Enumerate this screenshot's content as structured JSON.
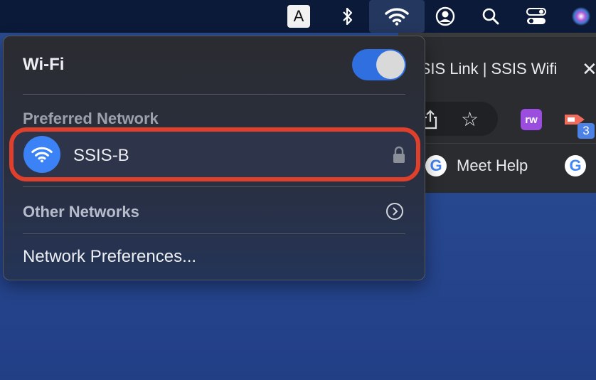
{
  "menubar": {
    "input_source_label": "A",
    "icons": [
      "input-source-icon",
      "bluetooth-icon",
      "wifi-icon",
      "user-icon",
      "search-icon",
      "control-center-icon",
      "siri-icon"
    ]
  },
  "browser": {
    "tab_title": "SSIS Link | SSIS Wifi",
    "close_label": "✕",
    "extension_badge": "3",
    "rw_extension_label": "rw",
    "bookmarks": [
      {
        "label": "Meet Help",
        "icon": "google-icon"
      }
    ]
  },
  "wifi_menu": {
    "title": "Wi-Fi",
    "toggle_on": true,
    "accent_color": "#2f6fe0",
    "preferred_label": "Preferred Network",
    "preferred_network": {
      "name": "SSIS-B",
      "secured": true
    },
    "highlight_color": "#e0402b",
    "other_networks_label": "Other Networks",
    "preferences_label": "Network Preferences..."
  }
}
